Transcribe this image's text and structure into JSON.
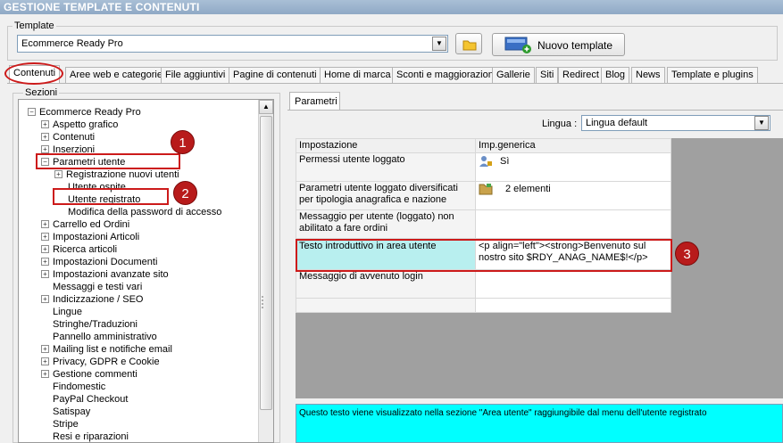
{
  "window": {
    "title": "GESTIONE TEMPLATE E CONTENUTI"
  },
  "template_group": {
    "label": "Template",
    "selected": "Ecommerce Ready Pro",
    "new_button": "Nuovo template"
  },
  "tabs": [
    "Contenuti",
    "Aree web e categorie",
    "File aggiuntivi",
    "Pagine di contenuti",
    "Home di marca",
    "Sconti e maggiorazioni",
    "Gallerie",
    "Siti",
    "Redirect",
    "Blog",
    "News",
    "Template e plugins"
  ],
  "sections": {
    "label": "Sezioni",
    "tree": [
      "Ecommerce Ready Pro",
      "Aspetto grafico",
      "Contenuti",
      "Inserzioni",
      "Parametri utente",
      "Registrazione nuovi utenti",
      "Utente ospite",
      "Utente registrato",
      "Modifica della password di accesso",
      "Carrello ed Ordini",
      "Impostazioni Articoli",
      "Ricerca articoli",
      "Impostazioni Documenti",
      "Impostazioni avanzate sito",
      "Messaggi e testi vari",
      "Indicizzazione / SEO",
      "Lingue",
      "Stringhe/Traduzioni",
      "Pannello amministrativo",
      "Mailing list e notifiche email",
      "Privacy, GDPR e Cookie",
      "Gestione commenti",
      "Findomestic",
      "PayPal Checkout",
      "Satispay",
      "Stripe",
      "Resi e riparazioni"
    ]
  },
  "params": {
    "tab": "Parametri",
    "lingua_label": "Lingua :",
    "lingua_value": "Lingua default",
    "header": [
      "Impostazione",
      "Imp.generica"
    ],
    "rows": [
      {
        "name": "Permessi utente loggato",
        "value": "Sì"
      },
      {
        "name": "Parametri utente loggato diversificati per tipologia anagrafica e nazione",
        "value": "2 elementi"
      },
      {
        "name": "Messaggio per utente (loggato) non abilitato a fare ordini",
        "value": ""
      },
      {
        "name": "Testo introduttivo in area utente",
        "value": "<p align=\"left\"><strong>Benvenuto sul nostro sito $RDY_ANAG_NAME$!</p>"
      },
      {
        "name": "Messaggio di avvenuto login",
        "value": ""
      },
      {
        "name": "",
        "value": ""
      }
    ],
    "description": "Questo testo viene visualizzato nella sezione \"Area utente\" raggiungibile dal menu dell'utente registrato"
  },
  "badges": [
    "1",
    "2",
    "3"
  ],
  "colors": {
    "highlight": "#cc1a1a",
    "selected_row": "#b8efef",
    "description_bg": "#00ffff"
  }
}
